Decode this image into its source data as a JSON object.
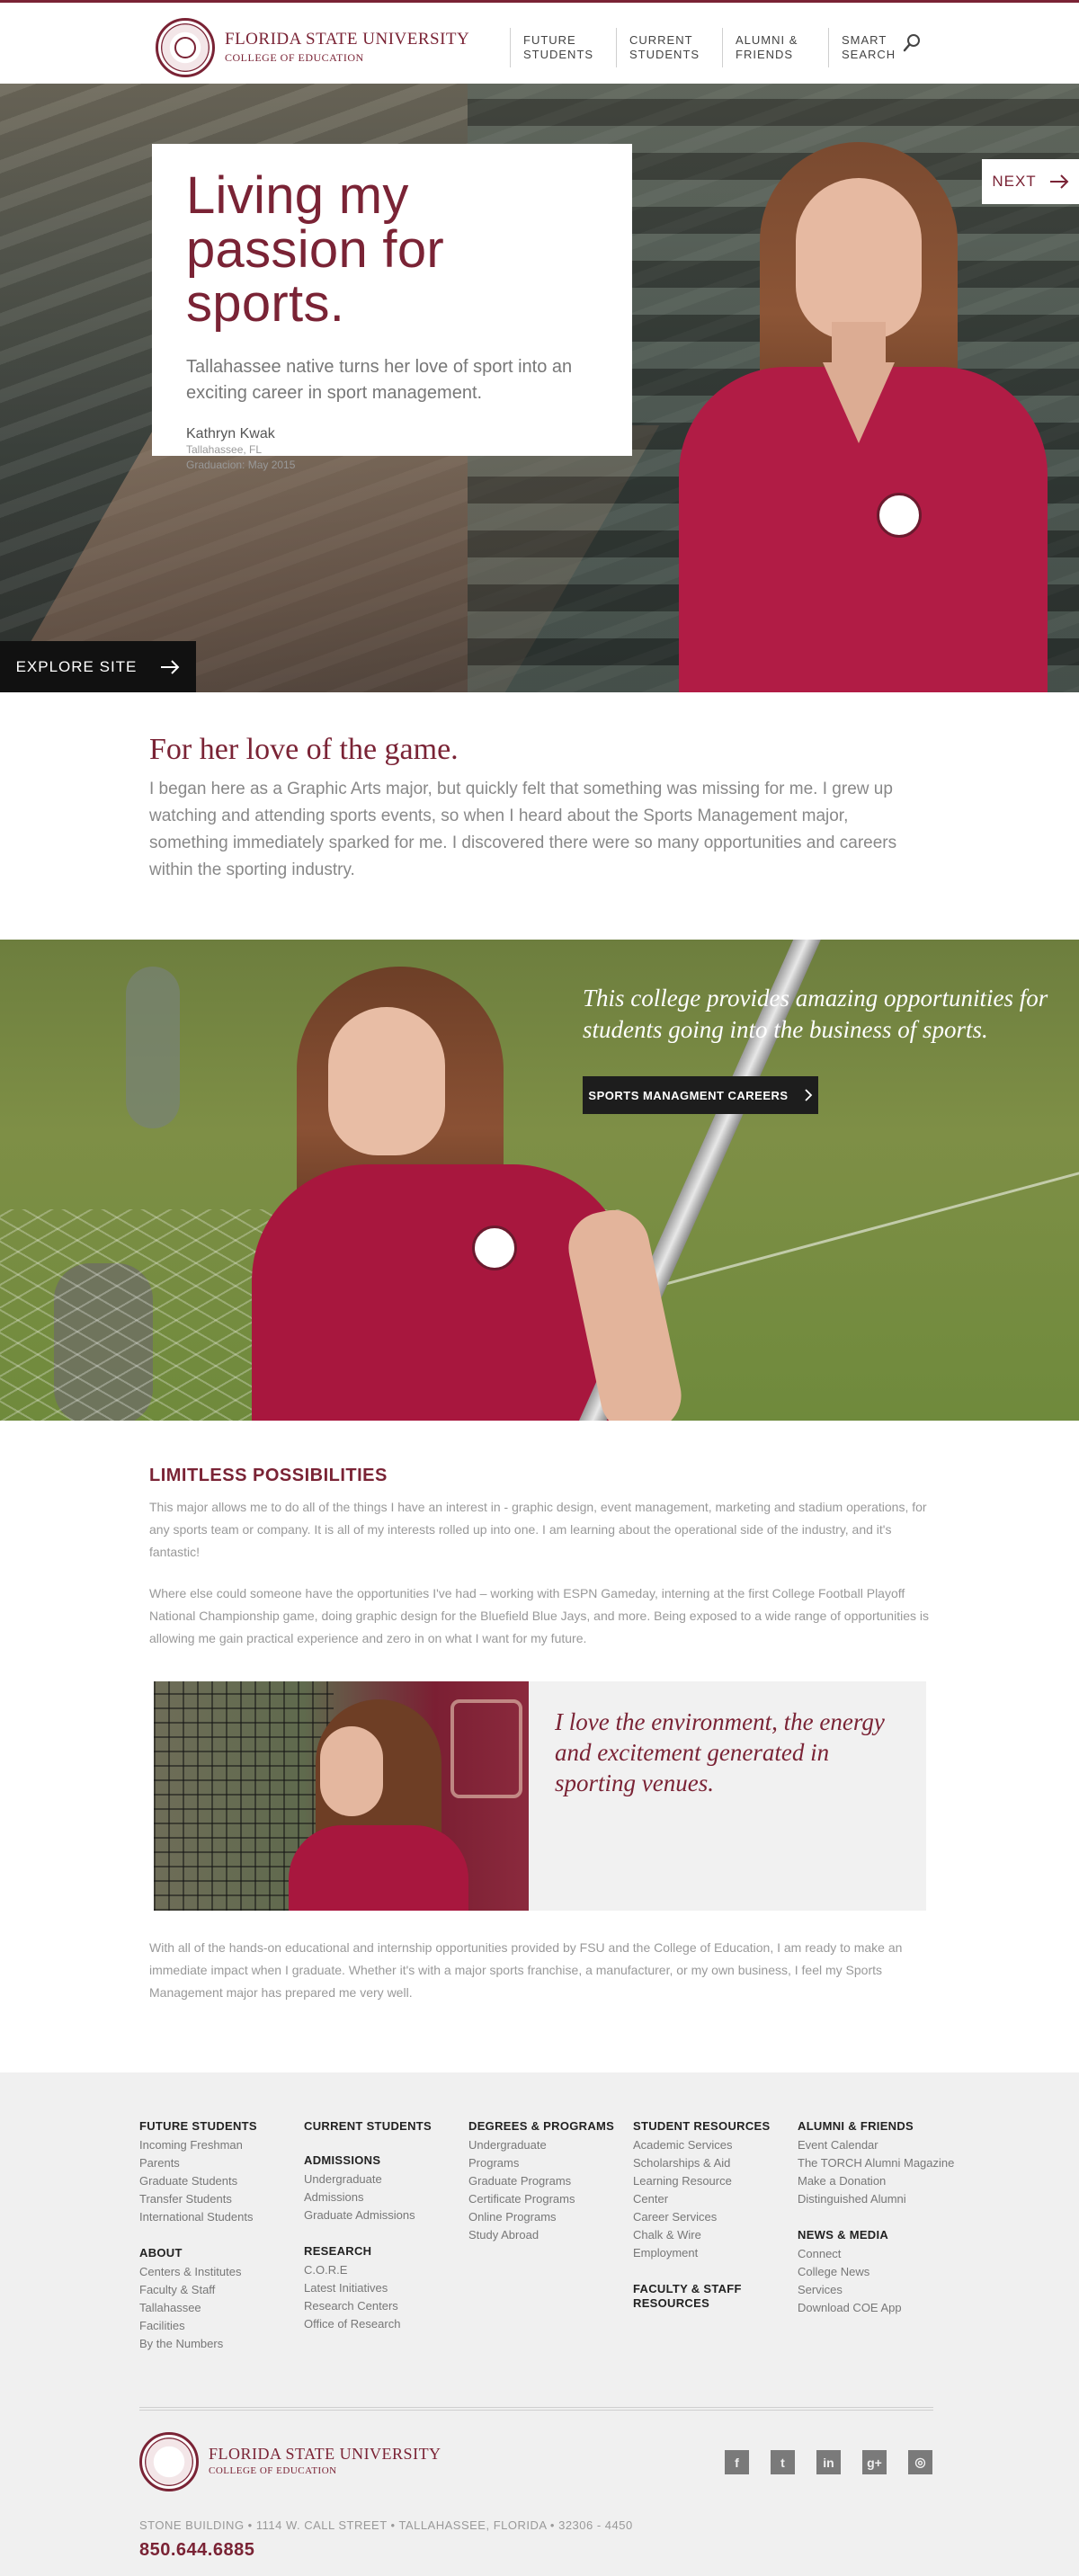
{
  "header": {
    "university": "FLORIDA STATE UNIVERSITY",
    "college": "COLLEGE OF EDUCATION",
    "nav": [
      {
        "line1": "FUTURE",
        "line2": "STUDENTS"
      },
      {
        "line1": "CURRENT",
        "line2": "STUDENTS"
      },
      {
        "line1": "ALUMNI &",
        "line2": "FRIENDS"
      },
      {
        "line1": "SMART",
        "line2": "SEARCH"
      }
    ],
    "search_icon": "search-icon"
  },
  "hero": {
    "title": "Living my passion for sports.",
    "subtitle": "Tallahassee native turns her love of sport into an exciting career in sport management.",
    "name": "Kathryn Kwak",
    "hometown": "Tallahassee, FL",
    "graduation": "Graduacion: May 2015",
    "next_label": "NEXT",
    "explore_label": "EXPLORE SITE"
  },
  "intro": {
    "title": "For her love of the game.",
    "body": "I began here as a Graphic Arts major, but quickly felt that something was missing for me. I grew up watching and attending sports events, so when I heard about the Sports Management major, something immediately sparked for me. I discovered there were so many opportunities and careers within the sporting industry."
  },
  "banner": {
    "quote": "This college provides amazing opportunities for students going into the business of sports.",
    "button_label": "SPORTS MANAGMENT CAREERS"
  },
  "limitless": {
    "title": "LIMITLESS POSSIBILITIES",
    "p1": "This major allows me to do all of the things I have an interest in - graphic design, event management, marketing and stadium operations, for any sports team or company. It is all of my interests rolled up into one. I am learning about the operational side of the industry, and it's fantastic!",
    "p2": "Where else could someone have the opportunities I've had – working with ESPN Gameday, interning at the first College Football Playoff National Championship game, doing graphic design for the Bluefield Blue Jays, and more. Being exposed to a wide range of opportunities is allowing me gain practical experience and zero in on what I want for my future.",
    "feature_quote": "I love the environment, the energy and excitement generated in sporting venues.",
    "p3": "With all of the hands-on educational and internship opportunities provided by FSU and the College of Education, I am ready to make an immediate impact when I graduate. Whether it's with a major sports franchise, a manufacturer, or my own business, I feel my Sports Management major has prepared me very well."
  },
  "footer": {
    "col1": {
      "head1": "FUTURE STUDENTS",
      "links1": [
        "Incoming Freshman",
        "Parents",
        "Graduate Students",
        "Transfer Students",
        "International Students"
      ],
      "head2": "ABOUT",
      "links2": [
        "Centers & Institutes",
        "Faculty & Staff",
        "Tallahassee",
        "Facilities",
        "By the Numbers"
      ]
    },
    "col2": {
      "head1": "CURRENT STUDENTS",
      "head2": "ADMISSIONS",
      "links2": [
        "Undergraduate",
        "Admissions",
        "Graduate Admissions"
      ],
      "head3": "RESEARCH",
      "links3": [
        "C.O.R.E",
        "Latest Initiatives",
        "Research Centers",
        "Office of Research"
      ]
    },
    "col3": {
      "head1": "DEGREES & PROGRAMS",
      "links1": [
        "Undergraduate",
        "Programs",
        "Graduate Programs",
        "Certificate Programs",
        "Online Programs",
        "Study Abroad"
      ]
    },
    "col4": {
      "head1": "STUDENT RESOURCES",
      "links1": [
        "Academic Services",
        "Scholarships & Aid",
        "Learning Resource",
        "Center",
        "Career Services",
        "Chalk & Wire",
        "Employment"
      ],
      "head2_line1": "FACULTY & STAFF",
      "head2_line2": "RESOURCES"
    },
    "col5": {
      "head1": "ALUMNI & FRIENDS",
      "links1": [
        "Event Calendar",
        "The TORCH Alumni Magazine",
        "Make a Donation",
        "Distinguished Alumni"
      ],
      "head2": "NEWS & MEDIA",
      "links2": [
        "Connect",
        "College News",
        "Services",
        "Download COE App"
      ]
    },
    "university": "FLORIDA STATE UNIVERSITY",
    "college": "COLLEGE OF EDUCATION",
    "socials": [
      {
        "icon": "facebook-icon",
        "glyph": "f"
      },
      {
        "icon": "twitter-icon",
        "glyph": "t"
      },
      {
        "icon": "linkedin-icon",
        "glyph": "in"
      },
      {
        "icon": "google-plus-icon",
        "glyph": "g+"
      },
      {
        "icon": "instagram-icon",
        "glyph": "◎"
      }
    ],
    "address": "STONE BUILDING • 1114 W. CALL STREET • TALLAHASSEE, FLORIDA • 32306 - 4450",
    "phone": "850.644.6885"
  },
  "colors": {
    "garnet": "#7a2335",
    "footer_bg": "#f0f0f0",
    "dark_button": "#1d1d1d"
  }
}
